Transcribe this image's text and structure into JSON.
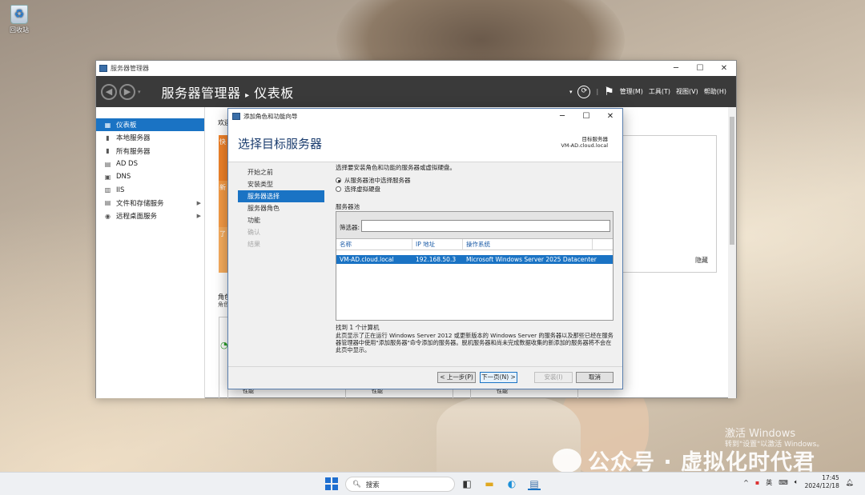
{
  "desktop": {
    "recycle_bin": "回收站"
  },
  "server_manager": {
    "title": "服务器管理器",
    "breadcrumb_app": "服务器管理器",
    "breadcrumb_sep": "▸",
    "breadcrumb_page": "仪表板",
    "menus": [
      "管理(M)",
      "工具(T)",
      "视图(V)",
      "帮助(H)"
    ],
    "sidebar": [
      {
        "label": "仪表板",
        "icon": "dashboard-icon",
        "selected": true
      },
      {
        "label": "本地服务器",
        "icon": "server-icon"
      },
      {
        "label": "所有服务器",
        "icon": "servers-icon"
      },
      {
        "label": "AD DS",
        "icon": "ad-ds-icon"
      },
      {
        "label": "DNS",
        "icon": "dns-icon"
      },
      {
        "label": "IIS",
        "icon": "iis-icon"
      },
      {
        "label": "文件和存储服务",
        "icon": "storage-icon",
        "arrow": true
      },
      {
        "label": "远程桌面服务",
        "icon": "remote-desktop-icon",
        "arrow": true
      }
    ],
    "welcome_fragment": "欢迎",
    "quickstart": [
      "快",
      "新",
      "了"
    ],
    "roles_fragment": "角色",
    "roles_sub": "角色",
    "hide": "隐藏",
    "bottom_labels": [
      "性能",
      "性能",
      "性能"
    ],
    "accent_orange": "#f0822a",
    "accent_blue": "#1a73c4"
  },
  "wizard": {
    "title": "添加角色和功能向导",
    "heading": "选择目标服务器",
    "dest_label": "目标服务器",
    "dest_value": "VM-AD.cloud.local",
    "steps": [
      {
        "label": "开始之前",
        "state": "normal"
      },
      {
        "label": "安装类型",
        "state": "normal"
      },
      {
        "label": "服务器选择",
        "state": "current"
      },
      {
        "label": "服务器角色",
        "state": "normal"
      },
      {
        "label": "功能",
        "state": "normal"
      },
      {
        "label": "确认",
        "state": "disabled"
      },
      {
        "label": "结果",
        "state": "disabled"
      }
    ],
    "intro": "选择要安装角色和功能的服务器或虚拟硬盘。",
    "radio_pool": "从服务器池中选择服务器",
    "radio_vhd": "选择虚拟硬盘",
    "pool_label": "服务器池",
    "filter_label": "筛选器:",
    "filter_value": "",
    "columns": [
      "名称",
      "IP 地址",
      "操作系统"
    ],
    "rows": [
      {
        "name": "VM-AD.cloud.local",
        "ip": "192.168.50.3",
        "os": "Microsoft Windows Server 2025 Datacenter"
      }
    ],
    "found": "找到 1 个计算机",
    "note": "此页显示了正在运行 Windows Server 2012 或更新版本的 Windows Server 的服务器以及那些已经在服务器管理器中使用\"添加服务器\"命令添加的服务器。脱机服务器和尚未完成数据收集的新添加的服务器将不会在此页中显示。",
    "btn_prev": "< 上一步(P)",
    "btn_next": "下一页(N) >",
    "btn_install": "安装(I)",
    "btn_cancel": "取消"
  },
  "watermark": {
    "line1": "激活 Windows",
    "line2": "转到\"设置\"以激活 Windows。",
    "wechat": "公众号 · 虚拟化时代君"
  },
  "taskbar": {
    "search": "搜索",
    "ime": "英",
    "time": "17:45",
    "date": "2024/12/18"
  }
}
